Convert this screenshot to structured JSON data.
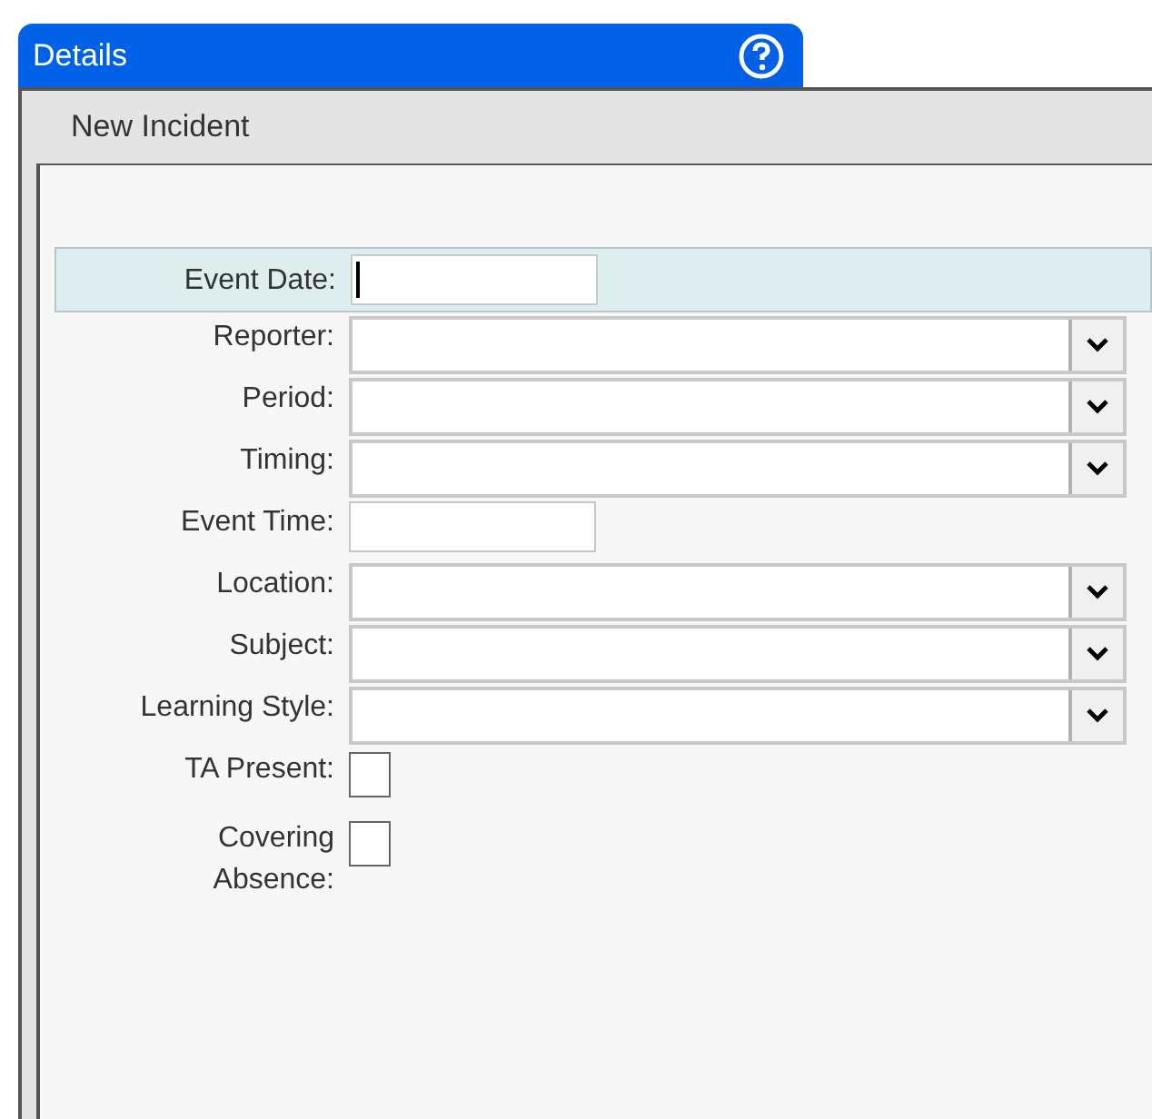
{
  "tab": {
    "title": "Details"
  },
  "panel": {
    "title": "New Incident"
  },
  "fields": [
    {
      "label": "Event Date:",
      "kind": "text",
      "focused": true
    },
    {
      "label": "Reporter:",
      "kind": "select",
      "focused": false
    },
    {
      "label": "Period:",
      "kind": "select",
      "focused": false
    },
    {
      "label": "Timing:",
      "kind": "select",
      "focused": false
    },
    {
      "label": "Event Time:",
      "kind": "text",
      "focused": false
    },
    {
      "label": "Location:",
      "kind": "select",
      "focused": false
    },
    {
      "label": "Subject:",
      "kind": "select",
      "focused": false
    },
    {
      "label": "Learning Style:",
      "kind": "select",
      "focused": false
    },
    {
      "label": "TA Present:",
      "kind": "checkbox",
      "checked": false,
      "focused": false
    },
    {
      "label": "Covering Absence:",
      "kind": "checkbox",
      "checked": false,
      "focused": false
    }
  ]
}
